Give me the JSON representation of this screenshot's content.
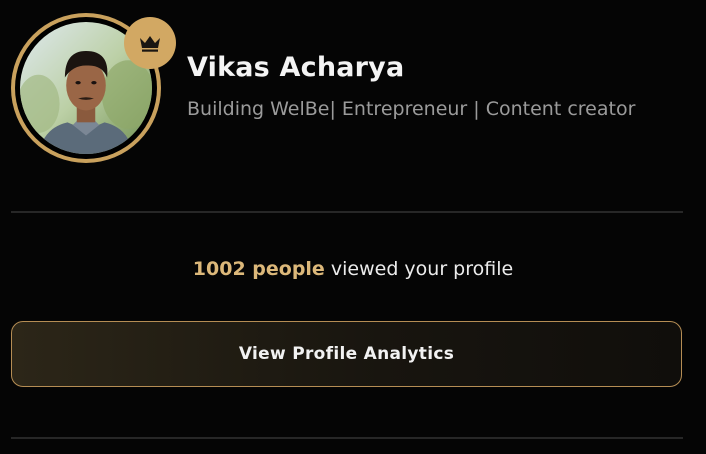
{
  "profile": {
    "name": "Vikas Acharya",
    "headline": "Building WelBe| Entrepreneur | Content creator",
    "premium_badge_icon": "crown-icon"
  },
  "views": {
    "count_text": "1002 people",
    "suffix_text": "viewed your profile"
  },
  "analytics_button": {
    "label": "View Profile Analytics"
  },
  "colors": {
    "accent_gold": "#d2a863",
    "background": "#050505",
    "button_border": "#b58d54"
  }
}
